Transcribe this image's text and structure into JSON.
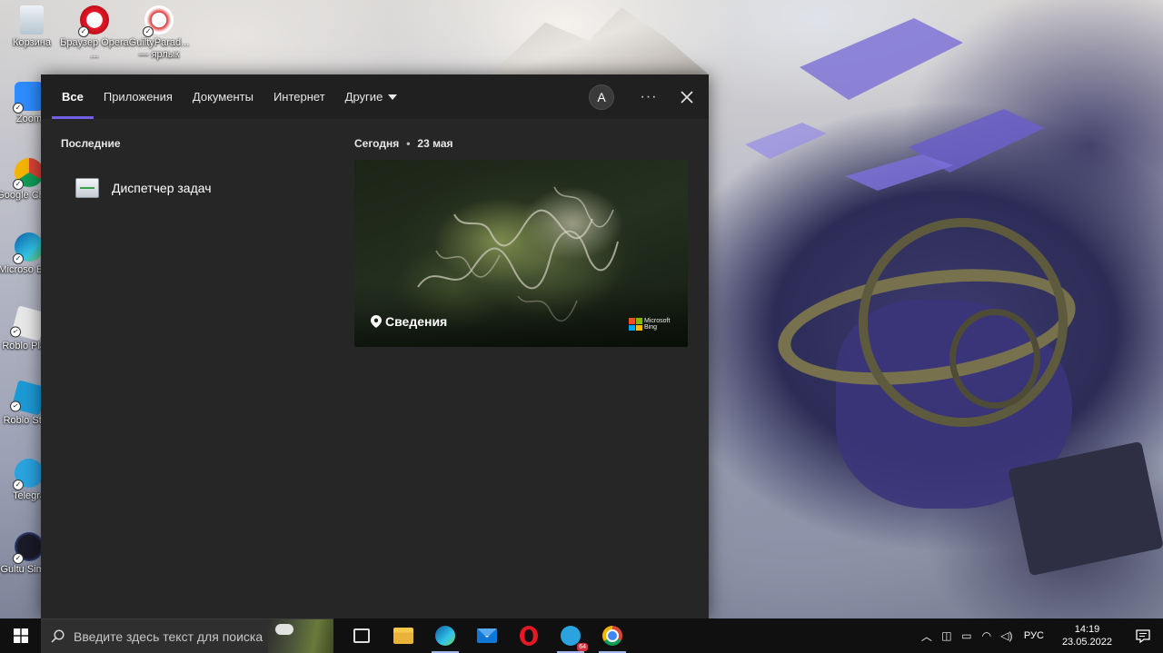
{
  "desktop": {
    "icons": [
      {
        "label": "Корзина",
        "icon": "recycle-bin-icon"
      },
      {
        "label": "Браузер Opera ...",
        "icon": "opera-icon"
      },
      {
        "label": "GuiltyParad... — ярлык",
        "icon": "guilty-paradise-icon"
      },
      {
        "label": "Zoom",
        "icon": "zoom-icon"
      },
      {
        "label": "Google Chrom",
        "icon": "chrome-icon"
      },
      {
        "label": "Microso Edge",
        "icon": "edge-icon"
      },
      {
        "label": "Roblo Playe",
        "icon": "roblox-player-icon"
      },
      {
        "label": "Roblo Studi",
        "icon": "roblox-studio-icon"
      },
      {
        "label": "Telegra",
        "icon": "telegram-icon"
      },
      {
        "label": "Gultu Simula",
        "icon": "game-icon"
      }
    ]
  },
  "search_panel": {
    "tabs": [
      {
        "label": "Все",
        "active": true
      },
      {
        "label": "Приложения",
        "active": false
      },
      {
        "label": "Документы",
        "active": false
      },
      {
        "label": "Интернет",
        "active": false
      },
      {
        "label": "Другие",
        "active": false
      }
    ],
    "avatar_letter": "A",
    "more_label": "···",
    "recent": {
      "title": "Последние",
      "items": [
        {
          "label": "Диспетчер задач",
          "icon": "task-manager-icon"
        }
      ]
    },
    "today": {
      "title": "Сегодня",
      "date": "23 мая",
      "card": {
        "label": "Сведения",
        "brand_line1": "Microsoft",
        "brand_line2": "Bing"
      }
    },
    "accent_color": "#7160e8"
  },
  "taskbar": {
    "search_placeholder": "Введите здесь текст для поиска",
    "apps": [
      {
        "name": "task-view",
        "icon": "task-view-icon"
      },
      {
        "name": "file-explorer",
        "icon": "folder-icon"
      },
      {
        "name": "edge",
        "icon": "edge-icon",
        "running": true
      },
      {
        "name": "mail",
        "icon": "mail-icon"
      },
      {
        "name": "opera",
        "icon": "opera-icon"
      },
      {
        "name": "telegram",
        "icon": "telegram-icon",
        "running": true,
        "badge": "64"
      },
      {
        "name": "chrome",
        "icon": "chrome-icon",
        "running": true
      }
    ],
    "tray": {
      "language": "РУС",
      "time": "14:19",
      "date": "23.05.2022"
    }
  }
}
